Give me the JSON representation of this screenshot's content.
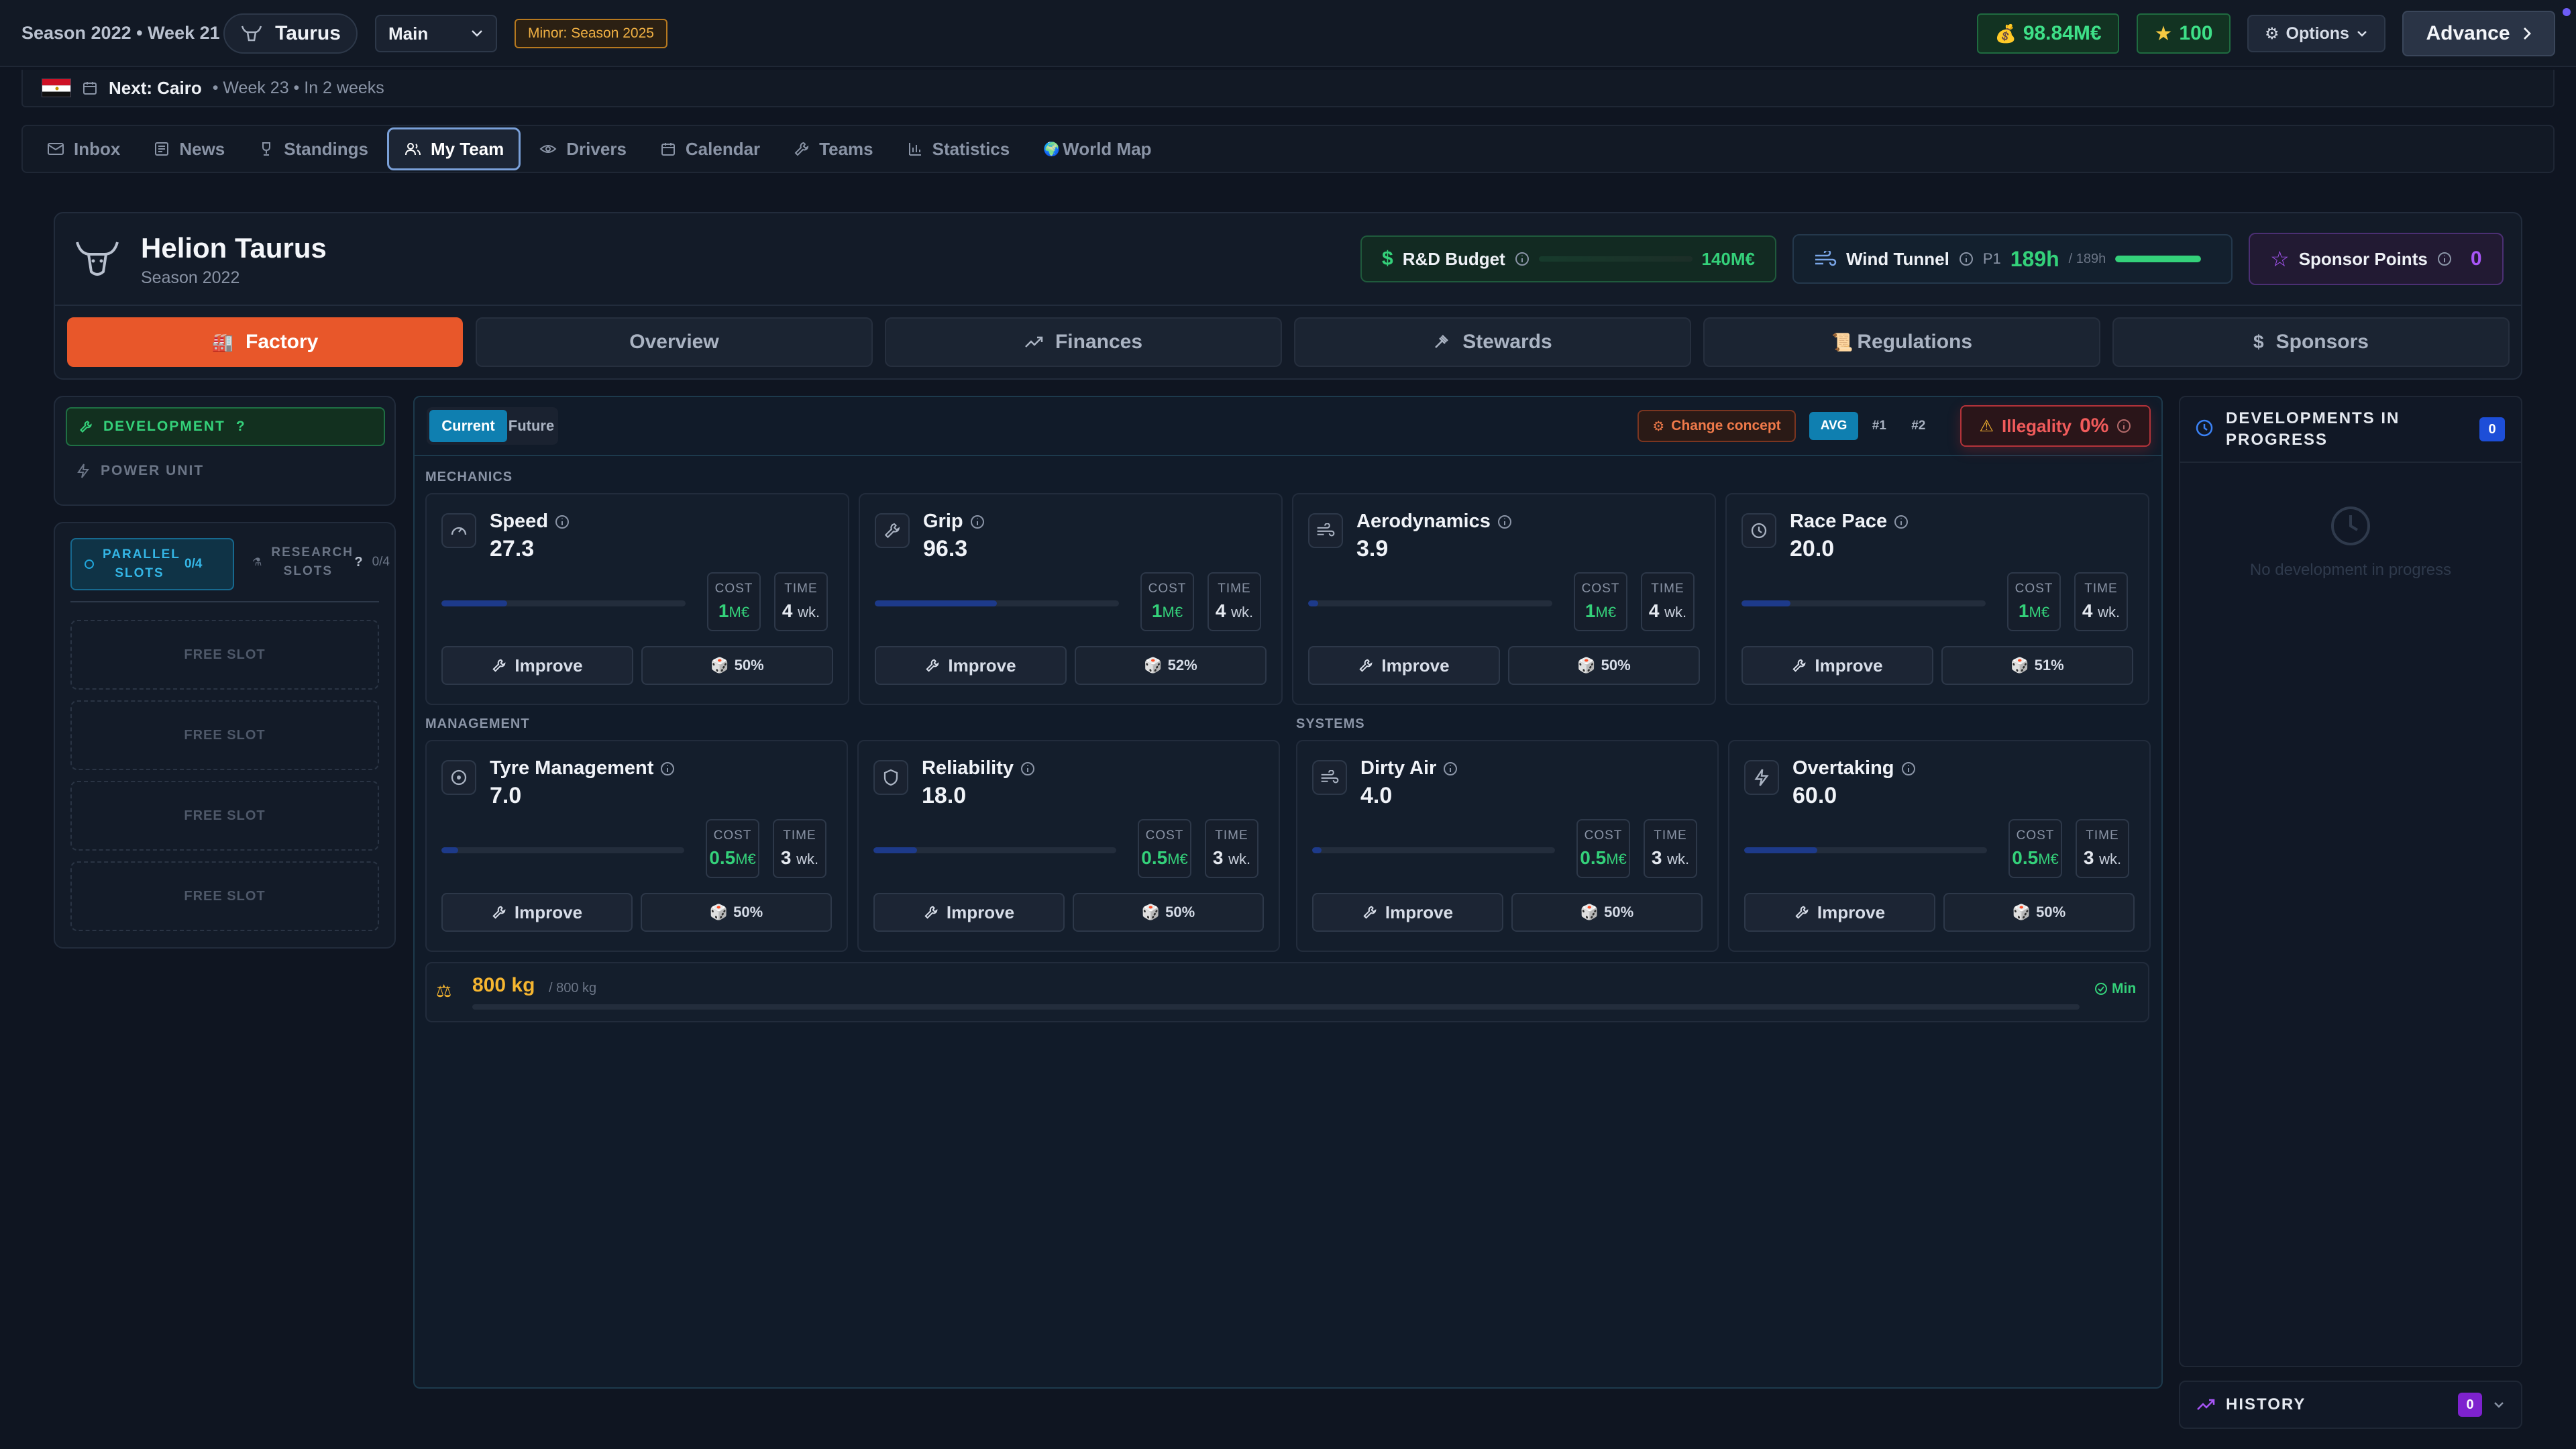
{
  "topbar": {
    "season_week": "Season 2022 • Week 21",
    "team_chip": "Taurus",
    "mode_select": "Main",
    "minor_badge": "Minor: Season 2025",
    "money": "98.84M€",
    "stars": "100",
    "options_label": "Options",
    "advance_label": "Advance"
  },
  "nextbar": {
    "next_label": "Next: Cairo",
    "detail": "• Week 23 • In 2 weeks"
  },
  "nav": {
    "tabs": [
      {
        "label": "Inbox",
        "icon": "mail-icon"
      },
      {
        "label": "News",
        "icon": "newspaper-icon"
      },
      {
        "label": "Standings",
        "icon": "trophy-icon"
      },
      {
        "label": "My Team",
        "icon": "users-icon",
        "active": true
      },
      {
        "label": "Drivers",
        "icon": "eye-icon"
      },
      {
        "label": "Calendar",
        "icon": "calendar-icon"
      },
      {
        "label": "Teams",
        "icon": "wrench-icon"
      },
      {
        "label": "Statistics",
        "icon": "bar-chart-icon"
      },
      {
        "label": "World Map",
        "icon": "globe-icon"
      }
    ]
  },
  "team": {
    "name": "Helion Taurus",
    "season": "Season 2022",
    "rd_budget_label": "R&D Budget",
    "rd_budget_value": "140M€",
    "wind_tunnel_label": "Wind Tunnel",
    "wind_tunnel_pos": "P1",
    "wind_tunnel_value": "189h",
    "wind_tunnel_max": "/ 189h",
    "wind_tunnel_fill": 1.0,
    "sponsor_label": "Sponsor Points",
    "sponsor_value": "0"
  },
  "subtabs": [
    {
      "label": "Factory",
      "icon": "factory-icon",
      "active": true
    },
    {
      "label": "Overview"
    },
    {
      "label": "Finances",
      "icon": "trending-up-icon"
    },
    {
      "label": "Stewards",
      "icon": "gavel-icon"
    },
    {
      "label": "Regulations",
      "icon": "scroll-icon"
    },
    {
      "label": "Sponsors",
      "icon": "dollar-icon"
    }
  ],
  "sidebar": {
    "development": "DEVELOPMENT",
    "development_help": "?",
    "power_unit": "POWER UNIT",
    "parallel_slots": "PARALLEL SLOTS",
    "parallel_count": "0/4",
    "research_slots": "RESEARCH SLOTS",
    "research_help": "?",
    "research_count": "0/4",
    "free_slots": [
      "FREE SLOT",
      "FREE SLOT",
      "FREE SLOT",
      "FREE SLOT"
    ]
  },
  "main": {
    "toggle_current": "Current",
    "toggle_future": "Future",
    "change_concept": "Change concept",
    "compare": [
      "AVG",
      "#1",
      "#2"
    ],
    "illegality_label": "Illegality",
    "illegality_value": "0%",
    "section_mechanics": "MECHANICS",
    "section_management": "MANAGEMENT",
    "section_systems": "SYSTEMS",
    "cost_label": "COST",
    "time_label": "TIME",
    "improve_label": "Improve",
    "mechanics": [
      {
        "name": "Speed",
        "value": "27.3",
        "cost": "1",
        "cost_unit": "M€",
        "time": "4",
        "time_unit": "wk.",
        "chance": "50%",
        "fill": 0.27,
        "icon": "gauge-icon"
      },
      {
        "name": "Grip",
        "value": "96.3",
        "cost": "1",
        "cost_unit": "M€",
        "time": "4",
        "time_unit": "wk.",
        "chance": "52%",
        "fill": 0.5,
        "icon": "wrench-icon"
      },
      {
        "name": "Aerodynamics",
        "value": "3.9",
        "cost": "1",
        "cost_unit": "M€",
        "time": "4",
        "time_unit": "wk.",
        "chance": "50%",
        "fill": 0.04,
        "icon": "wind-icon"
      },
      {
        "name": "Race Pace",
        "value": "20.0",
        "cost": "1",
        "cost_unit": "M€",
        "time": "4",
        "time_unit": "wk.",
        "chance": "51%",
        "fill": 0.2,
        "icon": "clock-icon"
      }
    ],
    "management": [
      {
        "name": "Tyre Management",
        "value": "7.0",
        "cost": "0.5",
        "cost_unit": "M€",
        "time": "3",
        "time_unit": "wk.",
        "chance": "50%",
        "fill": 0.07,
        "icon": "target-icon"
      },
      {
        "name": "Reliability",
        "value": "18.0",
        "cost": "0.5",
        "cost_unit": "M€",
        "time": "3",
        "time_unit": "wk.",
        "chance": "50%",
        "fill": 0.18,
        "icon": "shield-icon"
      }
    ],
    "systems": [
      {
        "name": "Dirty Air",
        "value": "4.0",
        "cost": "0.5",
        "cost_unit": "M€",
        "time": "3",
        "time_unit": "wk.",
        "chance": "50%",
        "fill": 0.04,
        "icon": "wind-icon"
      },
      {
        "name": "Overtaking",
        "value": "60.0",
        "cost": "0.5",
        "cost_unit": "M€",
        "time": "3",
        "time_unit": "wk.",
        "chance": "50%",
        "fill": 0.3,
        "icon": "zap-icon"
      }
    ],
    "weight_value": "800 kg",
    "weight_max": "/ 800 kg",
    "weight_min_label": "Min"
  },
  "right_panel": {
    "title": "DEVELOPMENTS IN PROGRESS",
    "count": "0",
    "empty_text": "No development in progress",
    "history_label": "HISTORY",
    "history_count": "0"
  },
  "colors": {
    "accent_orange": "#e8572a",
    "accent_green": "#34d17a",
    "accent_blue": "#0f7fb0",
    "accent_purple": "#a855f7",
    "danger_red": "#ef4444",
    "weight_yellow": "#f5b530"
  }
}
